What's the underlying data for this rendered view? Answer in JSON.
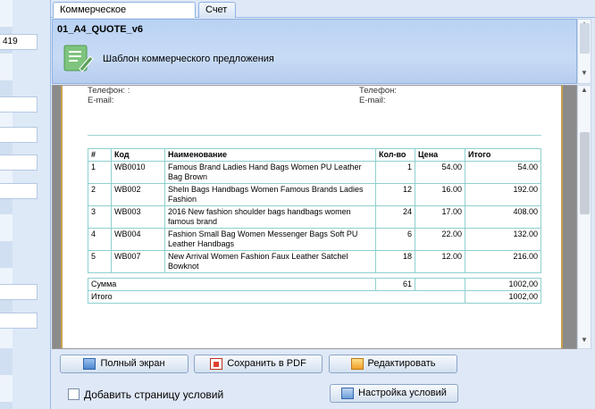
{
  "left_panel": {
    "partial_value": "419"
  },
  "tabs": [
    {
      "label": "Коммерческое предложение",
      "active": true
    },
    {
      "label": "Счет",
      "active": false
    }
  ],
  "header": {
    "title": "01_A4_QUOTE_v6",
    "subtitle": "Шаблон коммерческого предложения",
    "icon": "document-edit-icon"
  },
  "document": {
    "contact_left": {
      "phone_label": "Телефон:  :",
      "email_label": "E-mail:"
    },
    "contact_right": {
      "phone_label": "Телефон:",
      "email_label": "E-mail:"
    },
    "table": {
      "headers": [
        "#",
        "Код",
        "Наименование",
        "Кол-во",
        "Цена",
        "Итого"
      ],
      "rows": [
        [
          "1",
          "WB0010",
          "Famous Brand Ladies Hand Bags Women PU Leather Bag Brown",
          "1",
          "54.00",
          "54.00"
        ],
        [
          "2",
          "WB002",
          "SheIn Bags Handbags Women Famous Brands Ladies Fashion",
          "12",
          "16.00",
          "192.00"
        ],
        [
          "3",
          "WB003",
          "2016 New fashion shoulder bags handbags women famous brand",
          "24",
          "17.00",
          "408.00"
        ],
        [
          "4",
          "WB004",
          "Fashion Small Bag Women Messenger Bags Soft PU Leather Handbags",
          "6",
          "22.00",
          "132.00"
        ],
        [
          "5",
          "WB007",
          "New Arrival Women Fashion Faux Leather Satchel Bowknot",
          "18",
          "12.00",
          "216.00"
        ]
      ]
    },
    "totals": {
      "sum_label": "Сумма",
      "sum_qty": "61",
      "sum_value": "1002,00",
      "total_label": "Итого",
      "total_value": "1002,00"
    }
  },
  "buttons": {
    "fullscreen": "Полный экран",
    "save_pdf": "Сохранить в PDF",
    "edit": "Редактировать",
    "settings": "Настройка условий"
  },
  "checkbox": {
    "label": "Добавить страницу условий",
    "checked": false
  },
  "colors": {
    "header_bg": "#c8dbf6",
    "accent_border": "#c8a050",
    "table_border": "#8fcfcf"
  }
}
